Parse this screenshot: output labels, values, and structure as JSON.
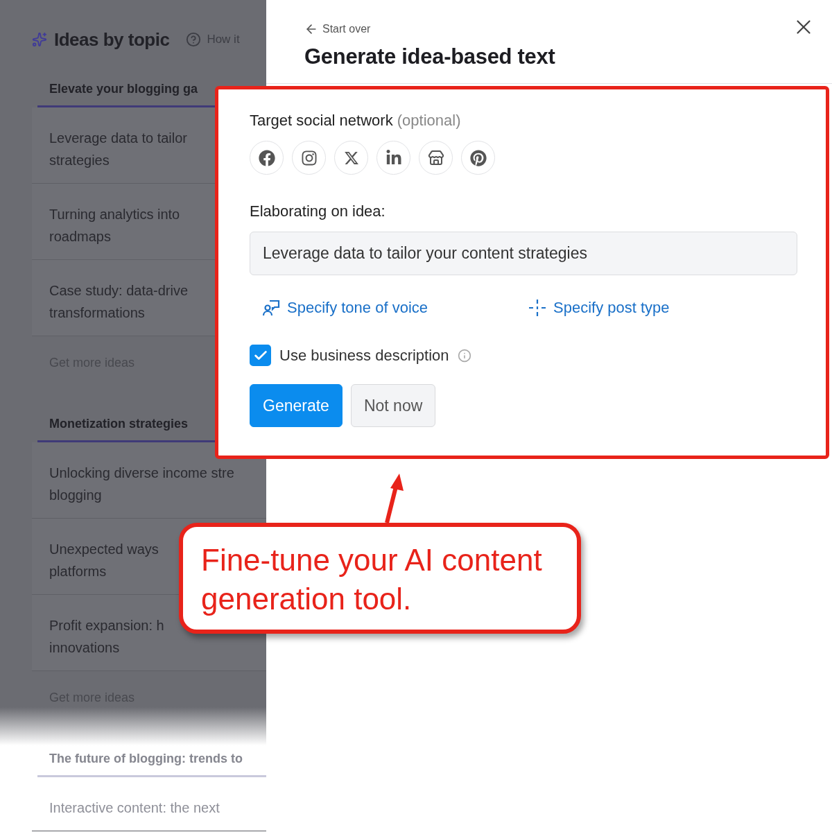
{
  "background_panel": {
    "title": "Ideas by topic",
    "help_link": "How it",
    "sections": [
      {
        "heading": "Elevate your blogging ga",
        "faded": false,
        "items": [
          {
            "lines": [
              "Leverage data to tailor",
              "strategies"
            ]
          },
          {
            "lines": [
              "Turning analytics into",
              "roadmaps"
            ]
          },
          {
            "lines": [
              "Case study: data-drive",
              "transformations"
            ]
          }
        ],
        "more": "Get more ideas"
      },
      {
        "heading": "Monetization strategies",
        "faded": false,
        "items": [
          {
            "lines": [
              "Unlocking diverse income stre",
              "blogging"
            ]
          },
          {
            "lines": [
              "Unexpected ways",
              "platforms"
            ]
          },
          {
            "lines": [
              "Profit expansion: h",
              "innovations"
            ]
          }
        ],
        "more": "Get more ideas"
      },
      {
        "heading": "The future of blogging: trends to",
        "faded": true,
        "items": [
          {
            "lines": [
              "Interactive content: the next"
            ]
          }
        ]
      }
    ]
  },
  "drawer": {
    "back": "Start over",
    "title": "Generate idea-based text",
    "network_label": "Target social network",
    "network_hint": "(optional)",
    "networks": [
      {
        "kind": "facebook"
      },
      {
        "kind": "instagram"
      },
      {
        "kind": "x"
      },
      {
        "kind": "linkedin"
      },
      {
        "kind": "store"
      },
      {
        "kind": "pinterest"
      }
    ],
    "idea_label": "Elaborating on idea:",
    "idea_value": "Leverage data to tailor your content strategies",
    "links": [
      {
        "kind": "tone",
        "label": "Specify tone of voice"
      },
      {
        "kind": "post",
        "label": "Specify post type"
      }
    ],
    "checkbox": {
      "label": "Use business description",
      "checked": true
    },
    "buttons": [
      {
        "kind": "primary",
        "label": "Generate"
      },
      {
        "kind": "secondary",
        "label": "Not now"
      }
    ]
  },
  "callout": {
    "text": "Fine-tune your AI content generation tool."
  }
}
